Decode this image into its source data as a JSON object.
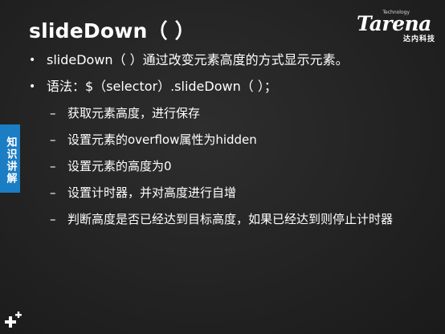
{
  "slide": {
    "title": "slideDown（ ）",
    "logo": {
      "wordmark": "Tarena",
      "tagline": "Technology",
      "cn": "达内科技"
    },
    "side_tab": "知识讲解",
    "bullets": [
      {
        "text": "slideDown（ ）通过改变元素高度的方式显示元素。"
      },
      {
        "text": "语法：$（selector）.slideDown（ ）；"
      }
    ],
    "sub_bullets": [
      "获取元素高度，进行保存",
      "设置元素的overflow属性为hidden",
      "设置元素的高度为0",
      "设置计时器，并对高度进行自增",
      "判断高度是否已经达到目标高度，如果已经达到则停止计时器"
    ],
    "bullet_symbol": "•",
    "sub_symbol": "–"
  }
}
